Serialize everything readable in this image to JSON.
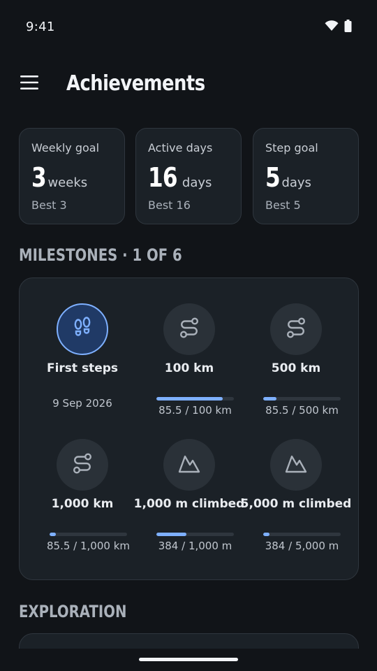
{
  "status_bar": {
    "time": "9:41"
  },
  "header": {
    "title": "Achievements"
  },
  "stats": [
    {
      "label": "Weekly goal",
      "value": "3",
      "unit": "weeks",
      "best": "Best 3"
    },
    {
      "label": "Active days",
      "value": "16",
      "unit": "days",
      "best": "Best 16"
    },
    {
      "label": "Step goal",
      "value": "5",
      "unit": "days",
      "best": "Best 5"
    }
  ],
  "milestones": {
    "title": "MILESTONES · 1 OF 6",
    "items": [
      {
        "name": "First steps",
        "icon": "footprints-icon",
        "completed": true,
        "date": "9 Sep 2026"
      },
      {
        "name": "100 km",
        "icon": "route-icon",
        "completed": false,
        "progress_text": "85.5 / 100 km",
        "progress": 0.855
      },
      {
        "name": "500 km",
        "icon": "route-icon",
        "completed": false,
        "progress_text": "85.5 / 500 km",
        "progress": 0.171
      },
      {
        "name": "1,000 km",
        "icon": "route-icon",
        "completed": false,
        "progress_text": "85.5 / 1,000 km",
        "progress": 0.0855
      },
      {
        "name": "1,000 m climbed",
        "icon": "mountain-icon",
        "completed": false,
        "progress_text": "384 / 1,000 m",
        "progress": 0.384
      },
      {
        "name": "5,000 m climbed",
        "icon": "mountain-icon",
        "completed": false,
        "progress_text": "384 / 5,000 m",
        "progress": 0.0768
      }
    ]
  },
  "exploration": {
    "title": "EXPLORATION"
  },
  "colors": {
    "background": "#111418",
    "card": "#1b2127",
    "accent": "#7eb0ff",
    "completed_badge": "#203a66"
  }
}
